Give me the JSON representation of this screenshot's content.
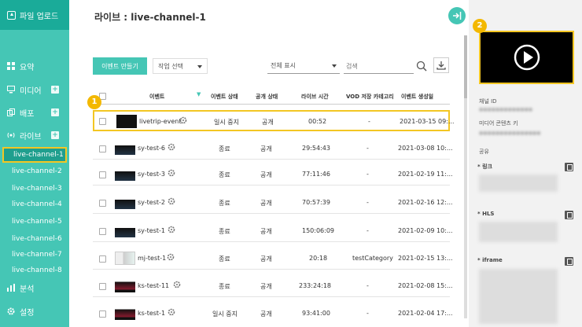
{
  "sidebar": {
    "upload_label": "파일 업로드",
    "nav": [
      {
        "label": "요약",
        "icon": "grid-icon"
      },
      {
        "label": "미디어",
        "icon": "monitor-icon",
        "plus": "+"
      },
      {
        "label": "배포",
        "icon": "copy-icon",
        "plus": "+"
      },
      {
        "label": "라이브",
        "icon": "broadcast-icon",
        "plus": "+"
      }
    ],
    "channels": [
      "live-channel-1",
      "live-channel-2",
      "live-channel-3",
      "live-channel-4",
      "live-channel-5",
      "live-channel-6",
      "live-channel-7",
      "live-channel-8"
    ],
    "bottom": [
      {
        "label": "분석",
        "icon": "bar-chart-icon"
      },
      {
        "label": "설정",
        "icon": "gear-icon"
      }
    ]
  },
  "header": {
    "title": "라이브 : live-channel-1",
    "toggle_icon": "panel-toggle-icon"
  },
  "toolbar": {
    "create_label": "이벤트 만들기",
    "action_select": "작업 선택",
    "view_select": "전체 표시",
    "search_placeholder": "검색"
  },
  "table": {
    "headers": [
      "이벤트",
      "이벤트 상태",
      "공개 상태",
      "라이브 시간",
      "VOD 저장 카테고리",
      "이벤트 생성일"
    ],
    "rows": [
      {
        "name": "livetrip-event",
        "status": "일시 중지",
        "public": "공개",
        "time": "00:52",
        "category": "-",
        "created": "2021-03-15 09:..."
      },
      {
        "name": "sy-test-6",
        "status": "종료",
        "public": "공개",
        "time": "29:54:43",
        "category": "-",
        "created": "2021-03-08 10:..."
      },
      {
        "name": "sy-test-3",
        "status": "종료",
        "public": "공개",
        "time": "77:11:46",
        "category": "-",
        "created": "2021-02-19 11:..."
      },
      {
        "name": "sy-test-2",
        "status": "종료",
        "public": "공개",
        "time": "70:57:39",
        "category": "-",
        "created": "2021-02-16 12:..."
      },
      {
        "name": "sy-test-1",
        "status": "종료",
        "public": "공개",
        "time": "150:06:09",
        "category": "-",
        "created": "2021-02-09 10:..."
      },
      {
        "name": "mj-test-1",
        "status": "종료",
        "public": "공개",
        "time": "20:18",
        "category": "testCategory",
        "created": "2021-02-15 13:..."
      },
      {
        "name": "ks-test-11",
        "status": "종료",
        "public": "공개",
        "time": "233:24:18",
        "category": "-",
        "created": "2021-02-08 15:..."
      },
      {
        "name": "ks-test-1",
        "status": "일시 중지",
        "public": "공개",
        "time": "93:41:00",
        "category": "-",
        "created": "2021-02-04 17:..."
      }
    ]
  },
  "right_panel": {
    "channel_id_label": "채널 ID",
    "channel_id_value": "●●●●●●●●●●●●●",
    "media_key_label": "미디어 콘텐츠 키",
    "media_key_value": "●●●●●●●●●●●●●●●",
    "share_label": "공유",
    "link_label": "* 링크",
    "hls_label": "* HLS",
    "iframe_label": "* iframe"
  },
  "badges": [
    "1",
    "2"
  ],
  "colors": {
    "accent": "#45c6b5",
    "sidebar_dark": "#1aab99",
    "highlight": "#f3c623"
  }
}
